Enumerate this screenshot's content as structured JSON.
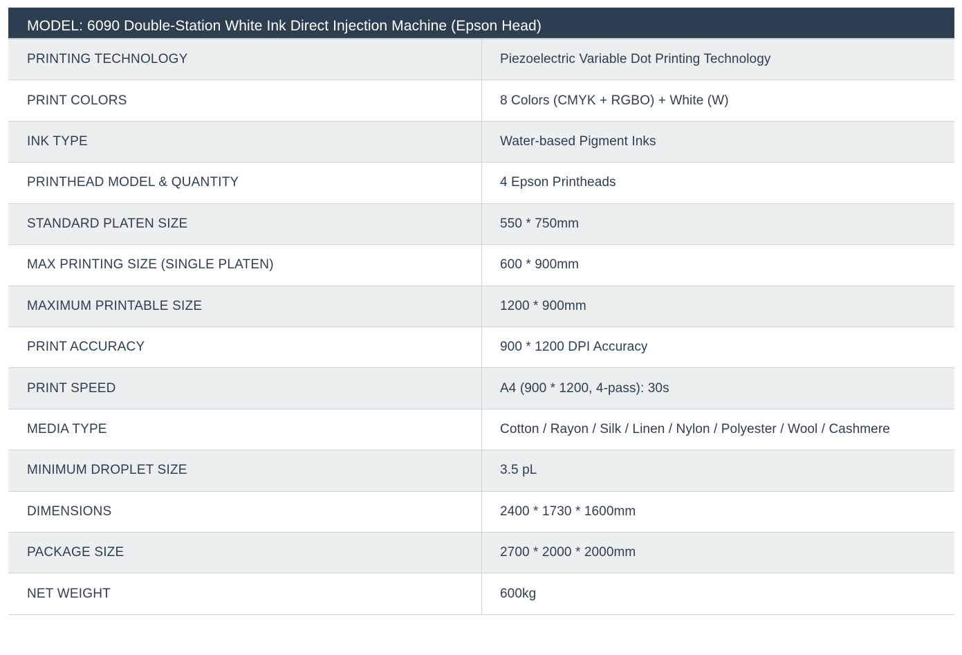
{
  "table": {
    "title": "MODEL: 6090 Double-Station White Ink Direct Injection Machine (Epson Head)",
    "rows": [
      {
        "label": "PRINTING TECHNOLOGY",
        "value": "Piezoelectric Variable Dot Printing Technology"
      },
      {
        "label": "PRINT COLORS",
        "value": "8 Colors (CMYK + RGBO) + White (W)"
      },
      {
        "label": "INK TYPE",
        "value": "Water-based Pigment Inks"
      },
      {
        "label": "PRINTHEAD MODEL & QUANTITY",
        "value": "4 Epson Printheads"
      },
      {
        "label": "STANDARD PLATEN SIZE",
        "value": "550 * 750mm"
      },
      {
        "label": "MAX PRINTING SIZE (SINGLE PLATEN)",
        "value": "600 * 900mm"
      },
      {
        "label": "MAXIMUM PRINTABLE SIZE",
        "value": "1200 * 900mm"
      },
      {
        "label": "PRINT ACCURACY",
        "value": "900 * 1200 DPI Accuracy"
      },
      {
        "label": "PRINT SPEED",
        "value": "A4 (900 * 1200, 4-pass): 30s"
      },
      {
        "label": "MEDIA TYPE",
        "value": "Cotton / Rayon / Silk / Linen / Nylon / Polyester / Wool / Cashmere"
      },
      {
        "label": "MINIMUM DROPLET SIZE",
        "value": "3.5 pL"
      },
      {
        "label": "DIMENSIONS",
        "value": "2400 * 1730 * 1600mm"
      },
      {
        "label": "PACKAGE SIZE",
        "value": "2700 * 2000 * 2000mm"
      },
      {
        "label": "NET WEIGHT",
        "value": "600kg"
      }
    ]
  },
  "colors": {
    "header_background": "#2e3e51",
    "header_text": "#ffffff",
    "row_stripe": "#ebeff0",
    "body_text": "#2e3e51",
    "border": "#cfd4d8"
  }
}
